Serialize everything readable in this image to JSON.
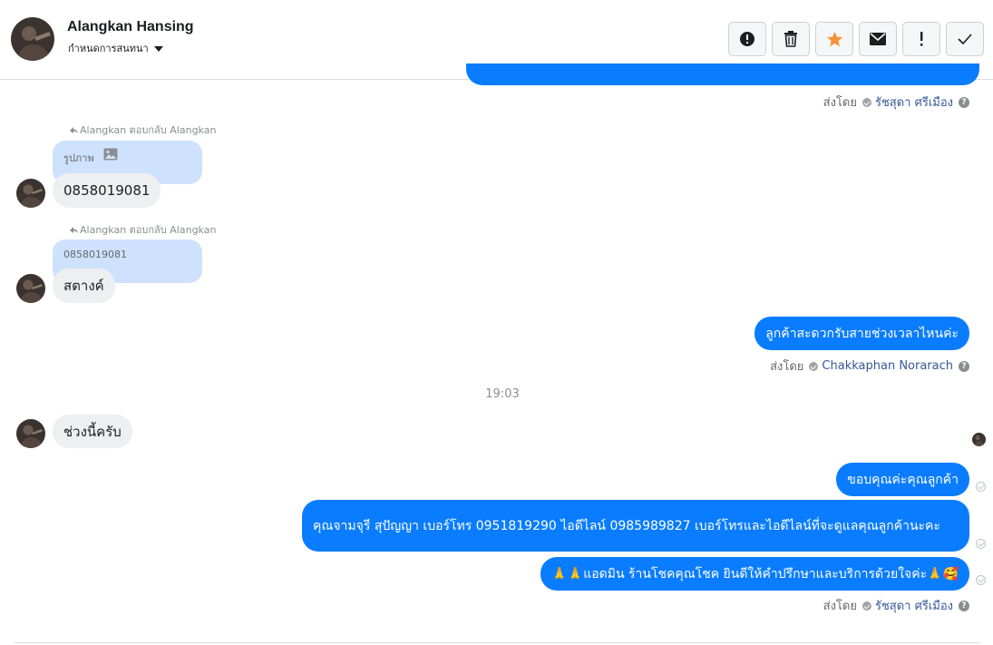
{
  "header": {
    "name": "Alangkan Hansing",
    "subtitle": "กำหนดการสนทนา",
    "actions": [
      {
        "name": "report-icon",
        "label": "!"
      },
      {
        "name": "trash-icon",
        "label": ""
      },
      {
        "name": "star-icon",
        "label": ""
      },
      {
        "name": "envelope-icon",
        "label": ""
      },
      {
        "name": "exclamation-icon",
        "label": "!"
      },
      {
        "name": "check-icon",
        "label": ""
      }
    ]
  },
  "messages": {
    "sent_by_1": {
      "prefix": "ส่งโดย",
      "name": "รัชสุดา ศรีเมือง"
    },
    "reply1": {
      "label": "Alangkan ตอบกลับ Alangkan",
      "quote": "รูปภาพ",
      "text": "0858019081"
    },
    "reply2": {
      "label": "Alangkan ตอบกลับ Alangkan",
      "quote": "0858019081",
      "text": "สตางค์"
    },
    "out1": {
      "text": "ลูกค้าสะดวกรับสายช่วงเวลาไหนค่ะ"
    },
    "sent_by_2": {
      "prefix": "ส่งโดย",
      "name": "Chakkaphan Norarach"
    },
    "time": "19:03",
    "in1": {
      "text": "ช่วงนี้ครับ"
    },
    "out2": {
      "text": "ขอบคุณค่ะคุณลูกค้า"
    },
    "out3": {
      "text": "คุณจามจุรี สุปัญญา เบอร์โทร 0951819290  ไอดีไลน์ 0985989827   เบอร์โทรและไอดีไลน์ที่จะดูแลคุณลูกค้านะคะ"
    },
    "out4": {
      "text": "🙏🙏แอดมิน ร้านโชคคุณโชค ยินดีให้คำปรึกษาและบริการด้วยใจค่ะ🙏🥰"
    },
    "sent_by_3": {
      "prefix": "ส่งโดย",
      "name": "รัชสุดา ศรีเมือง"
    }
  },
  "colors": {
    "outgoing": "#0a7cff",
    "incoming": "#eeeff1",
    "quote": "#cfe2fd",
    "star": "#f7923a"
  }
}
